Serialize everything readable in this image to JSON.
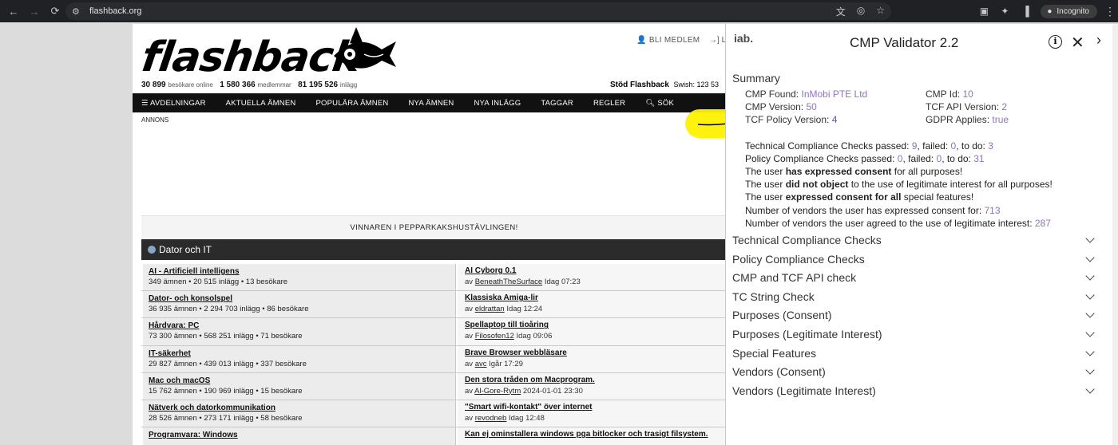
{
  "browser": {
    "url": "flashback.org",
    "incognito_label": "Incognito"
  },
  "site": {
    "logo_text": "flashback",
    "stats": [
      {
        "value": "30 899",
        "label": "besökare online"
      },
      {
        "value": "1 580 366",
        "label": "medlemmar"
      },
      {
        "value": "81 195 526",
        "label": "inlägg"
      }
    ],
    "support_label": "Stöd Flashback",
    "swish_label": "Swish: 123 53",
    "join_label": "BLI MEDLEM",
    "login_label": "L",
    "nav": [
      "AVDELNINGAR",
      "AKTUELLA ÄMNEN",
      "POPULÄRA ÄMNEN",
      "NYA ÄMNEN",
      "NYA INLÄGG",
      "TAGGAR",
      "REGLER",
      "SÖK"
    ],
    "annons": "ANNONS",
    "ad_title": "VINNAREN I PEPPARKAKSHUSTÄVLINGEN!",
    "category": "Dator och IT",
    "forums": [
      {
        "name": "AI - Artificiell intelligens",
        "meta": "349 ämnen • 20 515 inlägg • 13 besökare",
        "thread": "AI Cyborg 0.1",
        "author": "BeneathTheSurface",
        "time": "Idag 07:23"
      },
      {
        "name": "Dator- och konsolspel",
        "meta": "36 935 ämnen • 2 294 703 inlägg • 86 besökare",
        "thread": "Klassiska Amiga-lir",
        "author": "eldrattan",
        "time": "Idag 12:24"
      },
      {
        "name": "Hårdvara: PC",
        "meta": "73 300 ämnen • 568 251 inlägg • 71 besökare",
        "thread": "Spellaptop till tioåring",
        "author": "Filosofen12",
        "time": "Idag 09:06"
      },
      {
        "name": "IT-säkerhet",
        "meta": "29 827 ämnen • 439 013 inlägg • 337 besökare",
        "thread": "Brave Browser webbläsare",
        "author": "avc",
        "time": "Igår 17:29"
      },
      {
        "name": "Mac och macOS",
        "meta": "15 762 ämnen • 190 969 inlägg • 15 besökare",
        "thread": "Den stora tråden om Macprogram.",
        "author": "Al-Gore-Rytm",
        "time": "2024-01-01 23:30"
      },
      {
        "name": "Nätverk och datorkommunikation",
        "meta": "28 526 ämnen • 273 171 inlägg • 58 besökare",
        "thread": "\"Smart wifi-kontakt\" över internet",
        "author": "revodneb",
        "time": "Idag 12:48"
      },
      {
        "name": "Programvara: Windows",
        "meta": "",
        "thread": "Kan ej ominstallera windows pga bitlocker och trasigt filsystem.",
        "author": "",
        "time": ""
      }
    ],
    "by_prefix": "av"
  },
  "cmp": {
    "logo": "iab.",
    "title": "CMP Validator 2.2",
    "summary_label": "Summary",
    "fields": {
      "cmp_found_label": "CMP Found:",
      "cmp_found": "InMobi PTE Ltd",
      "cmp_version_label": "CMP Version:",
      "cmp_version": "50",
      "tcf_policy_label": "TCF Policy Version:",
      "tcf_policy": "4",
      "cmp_id_label": "CMP Id:",
      "cmp_id": "10",
      "tcf_api_label": "TCF API Version:",
      "tcf_api": "2",
      "gdpr_label": "GDPR Applies:",
      "gdpr": "true"
    },
    "checks": {
      "tech_prefix": "Technical Compliance Checks passed:",
      "tech_passed": "9",
      "tech_failed": "0",
      "tech_todo": "3",
      "policy_prefix": "Policy Compliance Checks passed:",
      "policy_passed": "0",
      "policy_failed": "0",
      "policy_todo": "31",
      "failed_label": ", failed:",
      "todo_label": ", to do:"
    },
    "consent": {
      "l1a": "The user ",
      "l1b": "has expressed consent",
      "l1c": " for all purposes!",
      "l2a": "The user ",
      "l2b": "did not object",
      "l2c": " to the use of legitimate interest for all purposes!",
      "l3a": "The user ",
      "l3b": "expressed consent for all",
      "l3c": " special features!",
      "vendors_consent_label": "Number of vendors the user has expressed consent for:",
      "vendors_consent": "713",
      "vendors_li_label": "Number of vendors the user agreed to the use of legitimate interest:",
      "vendors_li": "287"
    },
    "sections": [
      "Technical Compliance Checks",
      "Policy Compliance Checks",
      "CMP and TCF API check",
      "TC String Check",
      "Purposes (Consent)",
      "Purposes (Legitimate Interest)",
      "Special Features",
      "Vendors (Consent)",
      "Vendors (Legitimate Interest)"
    ]
  },
  "colors": {
    "value_purple": "#8f73bd",
    "highlight": "#fff200",
    "navbar": "#111111"
  }
}
